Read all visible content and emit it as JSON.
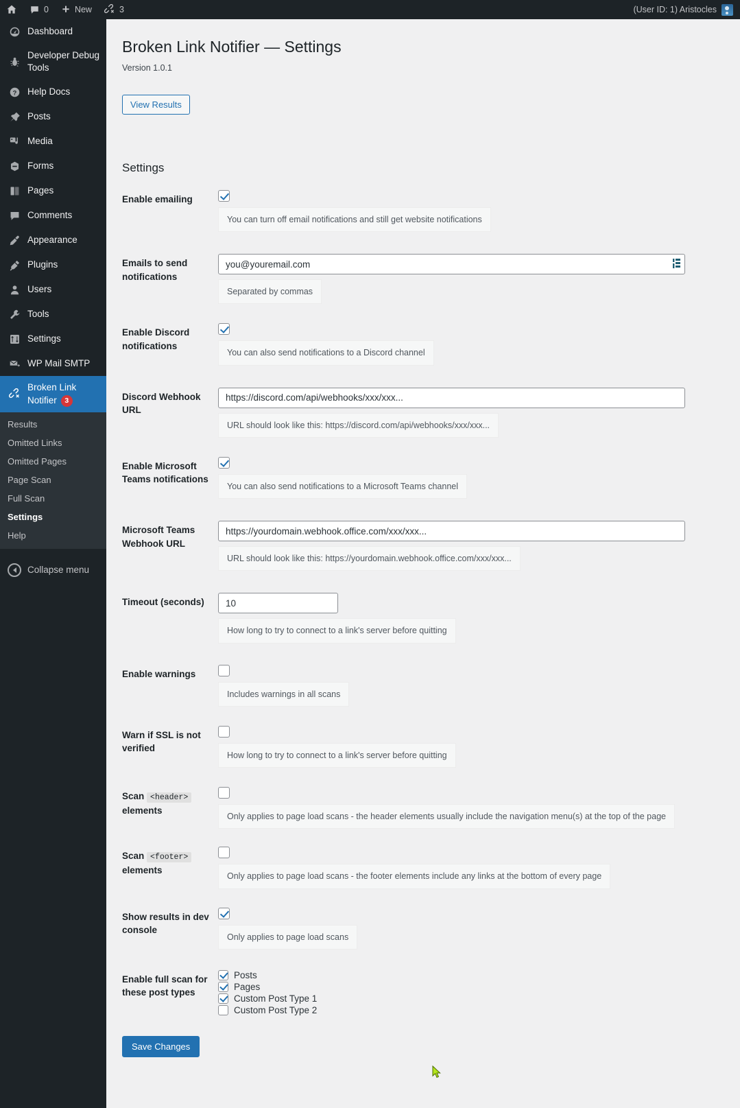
{
  "adminbar": {
    "home_icon": "wordpress-home-icon",
    "comments_icon": "comment-bubble-icon",
    "comments_count": "0",
    "new_icon": "plus-icon",
    "new_label": "New",
    "broken_link_icon": "broken-link-icon",
    "broken_link_count": "3",
    "user_label": "(User ID: 1) Aristocles",
    "avatar": "user-avatar"
  },
  "sidebar": {
    "items": [
      {
        "label": "Dashboard",
        "icon": "dashboard-icon"
      },
      {
        "label": "Developer Debug Tools",
        "icon": "bug-icon"
      },
      {
        "label": "Help Docs",
        "icon": "question-mark-icon"
      },
      {
        "label": "Posts",
        "icon": "pin-icon"
      },
      {
        "label": "Media",
        "icon": "media-icon"
      },
      {
        "label": "Forms",
        "icon": "forms-icon"
      },
      {
        "label": "Pages",
        "icon": "pages-icon"
      },
      {
        "label": "Comments",
        "icon": "comment-bubble-icon"
      },
      {
        "label": "Appearance",
        "icon": "paintbrush-icon"
      },
      {
        "label": "Plugins",
        "icon": "plug-icon"
      },
      {
        "label": "Users",
        "icon": "user-icon"
      },
      {
        "label": "Tools",
        "icon": "wrench-icon"
      },
      {
        "label": "Settings",
        "icon": "sliders-icon"
      },
      {
        "label": "WP Mail SMTP",
        "icon": "envelope-icon"
      }
    ],
    "current": {
      "label": "Broken Link Notifier",
      "icon": "broken-link-icon",
      "badge": "3"
    },
    "submenu": [
      {
        "label": "Results",
        "current": false
      },
      {
        "label": "Omitted Links",
        "current": false
      },
      {
        "label": "Omitted Pages",
        "current": false
      },
      {
        "label": "Page Scan",
        "current": false
      },
      {
        "label": "Full Scan",
        "current": false
      },
      {
        "label": "Settings",
        "current": true
      },
      {
        "label": "Help",
        "current": false
      }
    ],
    "collapse_label": "Collapse menu",
    "collapse_icon": "collapse-arrow-icon"
  },
  "page": {
    "title": "Broken Link Notifier — Settings",
    "version": "Version 1.0.1",
    "view_results_label": "View Results",
    "settings_heading": "Settings",
    "save_label": "Save Changes"
  },
  "fields": {
    "enable_emailing": {
      "label": "Enable emailing",
      "checked": true,
      "hint": "You can turn off email notifications and still get website notifications"
    },
    "emails": {
      "label": "Emails to send notifications",
      "value": "you@youremail.com",
      "hint": "Separated by commas",
      "autofill_icon": "autofill-icon"
    },
    "enable_discord": {
      "label": "Enable Discord notifications",
      "checked": true,
      "hint": "You can also send notifications to a Discord channel"
    },
    "discord_webhook": {
      "label": "Discord Webhook URL",
      "value": "https://discord.com/api/webhooks/xxx/xxx...",
      "hint": "URL should look like this: https://discord.com/api/webhooks/xxx/xxx..."
    },
    "enable_teams": {
      "label": "Enable Microsoft Teams notifications",
      "checked": true,
      "hint": "You can also send notifications to a Microsoft Teams channel"
    },
    "teams_webhook": {
      "label": "Microsoft Teams Webhook URL",
      "value": "https://yourdomain.webhook.office.com/xxx/xxx...",
      "hint": "URL should look like this: https://yourdomain.webhook.office.com/xxx/xxx..."
    },
    "timeout": {
      "label": "Timeout (seconds)",
      "value": "10",
      "hint": "How long to try to connect to a link's server before quitting"
    },
    "enable_warnings": {
      "label": "Enable warnings",
      "checked": false,
      "hint": "Includes warnings in all scans"
    },
    "warn_ssl": {
      "label": "Warn if SSL is not verified",
      "checked": false,
      "hint": "How long to try to connect to a link's server before quitting"
    },
    "scan_header": {
      "label_before": "Scan",
      "tag": "<header>",
      "label_after": "elements",
      "checked": false,
      "hint": "Only applies to page load scans - the header elements usually include the navigation menu(s) at the top of the page"
    },
    "scan_footer": {
      "label_before": "Scan",
      "tag": "<footer>",
      "label_after": "elements",
      "checked": false,
      "hint": "Only applies to page load scans - the footer elements include any links at the bottom of every page"
    },
    "dev_console": {
      "label": "Show results in dev console",
      "checked": true,
      "hint": "Only applies to page load scans"
    },
    "post_types": {
      "label": "Enable full scan for these post types",
      "options": [
        {
          "label": "Posts",
          "checked": true
        },
        {
          "label": "Pages",
          "checked": true
        },
        {
          "label": "Custom Post Type 1",
          "checked": true
        },
        {
          "label": "Custom Post Type 2",
          "checked": false
        }
      ]
    }
  },
  "colors": {
    "accent": "#2271b1",
    "sidebar_bg": "#1d2327",
    "submenu_bg": "#2c3338",
    "page_bg": "#f0f0f1",
    "badge": "#d63638"
  }
}
